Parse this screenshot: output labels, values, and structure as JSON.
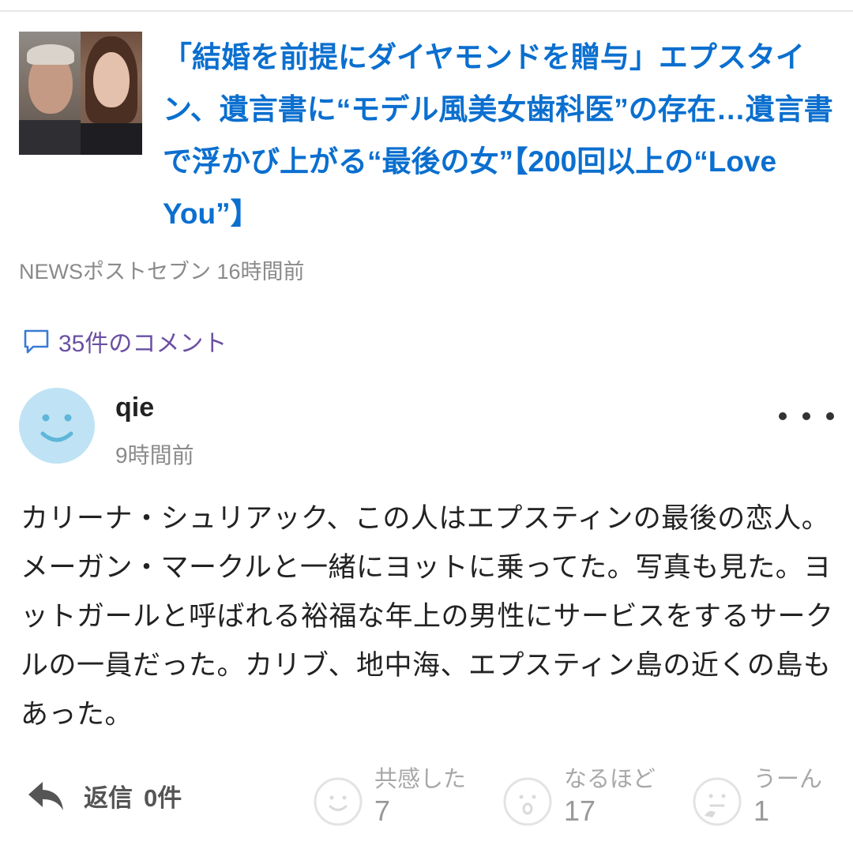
{
  "article": {
    "title": "「結婚を前提にダイヤモンドを贈与」エプスタイン、遺言書に“モデル風美女歯科医”の存在…遺言書で浮かび上がる“最後の女”【200回以上の“Love You”】",
    "source": "NEWSポストセブン",
    "time": "16時間前",
    "thumbnail": "two-portrait-thumbnail"
  },
  "comments_link": {
    "label": "35件のコメント",
    "icon": "comment-bubble-icon",
    "color": "#6a4fa3"
  },
  "comment": {
    "user": "qie",
    "time": "9時間前",
    "avatar_icon": "smiley-avatar-icon",
    "more_icon": "more-dots-icon",
    "body": "カリーナ・シュリアック、この人はエプスティンの最後の恋人。メーガン・マークルと一緒にヨットに乗ってた。写真も見た。ヨットガールと呼ばれる裕福な年上の男性にサービスをするサークルの一員だった。カリブ、地中海、エプスティン島の近くの島もあった。"
  },
  "actions": {
    "reply": {
      "label": "返信",
      "count": "0件",
      "icon": "reply-arrow-icon"
    },
    "reactions": [
      {
        "label": "共感した",
        "count": "7",
        "icon": "smile-face-icon"
      },
      {
        "label": "なるほど",
        "count": "17",
        "icon": "surprised-face-icon"
      },
      {
        "label": "うーん",
        "count": "1",
        "icon": "thinking-face-icon"
      }
    ]
  },
  "colors": {
    "title_link": "#0b6fcf",
    "muted_text": "#8a8a8a",
    "avatar_bg": "#bfe3f4"
  }
}
